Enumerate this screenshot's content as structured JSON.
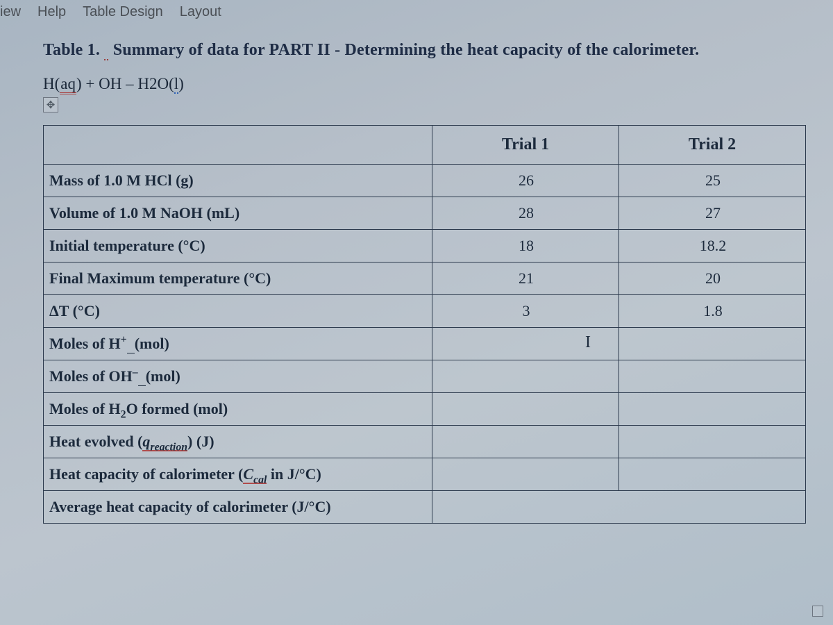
{
  "menu": {
    "view": "iew",
    "help": "Help",
    "table_design": "Table Design",
    "layout": "Layout"
  },
  "title": {
    "prefix": "Table 1.",
    "rest": "Summary of data for PART II - Determining the heat capacity of the calorimeter."
  },
  "equation": {
    "lhs_h": "H(",
    "aq": "aq",
    "lhs_close": ") + OH – H2O(",
    "l": "l",
    "end": ")"
  },
  "anchor_glyph": "✥",
  "headers": {
    "blank": "",
    "trial1": "Trial 1",
    "trial2": "Trial 2"
  },
  "rows": {
    "mass_hcl": {
      "label_html": "Mass of 1.0 M HCl (g)",
      "t1": "26",
      "t2": "25"
    },
    "vol_naoh": {
      "label_html": "Volume of 1.0 M NaOH (mL)",
      "t1": "28",
      "t2": "27"
    },
    "temp_init": {
      "label_html": "Initial temperature (°C)",
      "t1": "18",
      "t2": "18.2"
    },
    "temp_final": {
      "label_html": "Final Maximum temperature (°C)",
      "t1": "21",
      "t2": "20"
    },
    "delta_t": {
      "label_html": "ΔT (°C)",
      "t1": "3",
      "t2": "1.8"
    },
    "moles_h": {
      "label_html": "Moles of H<sup>+</sup><span class='subscript-under'>&nbsp;&nbsp;</span>(mol)",
      "t1": "",
      "t2": ""
    },
    "moles_oh": {
      "label_html": "Moles of OH<sup>–</sup><span class='subscript-under'>&nbsp;&nbsp;</span>(mol)",
      "t1": "",
      "t2": ""
    },
    "moles_h2o": {
      "label_html": "Moles of H<sub>2</sub>O formed (mol)",
      "t1": "",
      "t2": ""
    },
    "heat_evolved": {
      "label_html": "Heat evolved (<span class='ital red-under'>q<sub>reaction</sub></span>) (J)",
      "t1": "",
      "t2": ""
    },
    "heat_cap": {
      "label_html": "Heat capacity of calorimeter (<span class='ital red-under'>C<sub>cal</sub></span> in J/°C)",
      "t1": "",
      "t2": ""
    },
    "avg_heat_cap": {
      "label_html": "Average heat capacity of calorimeter (J/°C)",
      "merged": ""
    }
  },
  "cursor_glyph": "I",
  "chart_data": {
    "type": "table",
    "title": "Table 1. Summary of data for PART II - Determining the heat capacity of the calorimeter.",
    "columns": [
      "",
      "Trial 1",
      "Trial 2"
    ],
    "rows": [
      [
        "Mass of 1.0 M HCl (g)",
        26,
        25
      ],
      [
        "Volume of 1.0 M NaOH (mL)",
        28,
        27
      ],
      [
        "Initial temperature (°C)",
        18,
        18.2
      ],
      [
        "Final Maximum temperature (°C)",
        21,
        20
      ],
      [
        "ΔT (°C)",
        3,
        1.8
      ],
      [
        "Moles of H+ (mol)",
        null,
        null
      ],
      [
        "Moles of OH- (mol)",
        null,
        null
      ],
      [
        "Moles of H2O formed (mol)",
        null,
        null
      ],
      [
        "Heat evolved (q_reaction) (J)",
        null,
        null
      ],
      [
        "Heat capacity of calorimeter (C_cal in J/°C)",
        null,
        null
      ],
      [
        "Average heat capacity of calorimeter (J/°C)",
        null,
        null
      ]
    ]
  }
}
